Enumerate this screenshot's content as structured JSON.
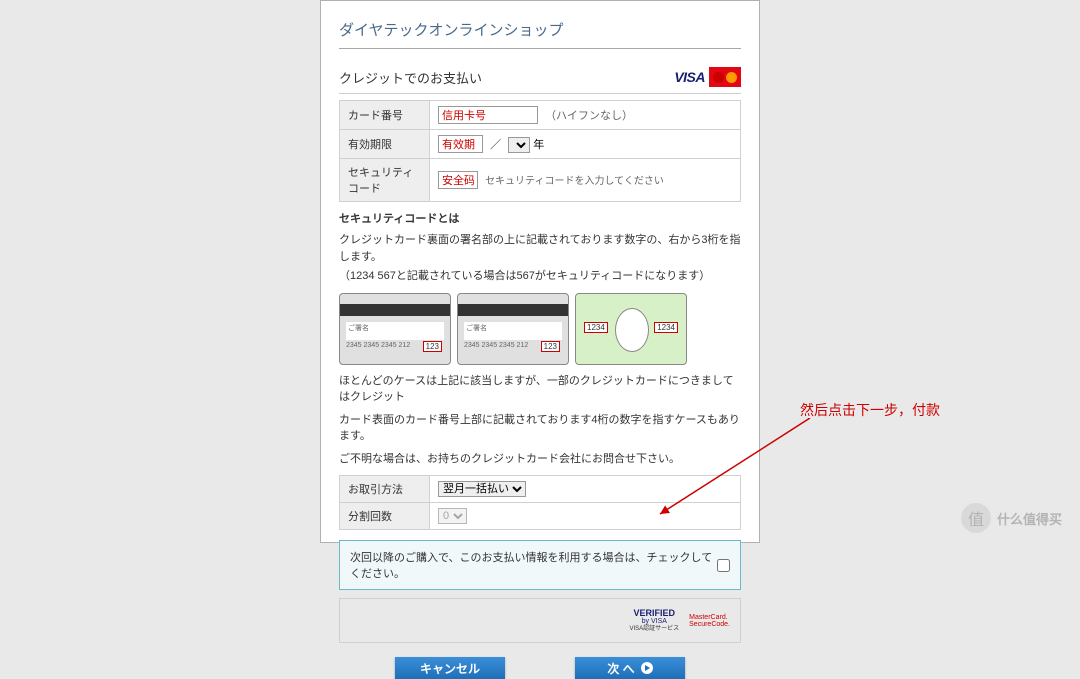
{
  "shop_title": "ダイヤテックオンラインショップ",
  "section_title": "クレジットでのお支払い",
  "logos": {
    "visa": "VISA",
    "mastercard": "MasterCard"
  },
  "form": {
    "card_number": {
      "label": "カード番号",
      "value": "信用卡号",
      "hint": "（ハイフンなし）"
    },
    "expiry": {
      "label": "有効期限",
      "month_value": "有效期",
      "slash": "／",
      "year_suffix": "年"
    },
    "security": {
      "label": "セキュリティコード",
      "value": "安全码",
      "placeholder": "セキュリティコードを入力してください"
    },
    "method": {
      "label": "お取引方法",
      "selected": "翌月一括払い"
    },
    "installments": {
      "label": "分割回数",
      "value": "0"
    }
  },
  "sec_info": {
    "title": "セキュリティコードとは",
    "desc1": "クレジットカード裏面の署名部の上に記載されております数字の、右から3桁を指します。",
    "desc2": "（1234 567と記載されている場合は567がセキュリティコードになります）",
    "sig_label": "ご署名",
    "card_nums": "2345 2345 2345 212",
    "code3": "123",
    "code4": "1234",
    "note1": "ほとんどのケースは上記に該当しますが、一部のクレジットカードにつきましてはクレジット",
    "note2": "カード表面のカード番号上部に記載されております4桁の数字を指すケースもあります。",
    "note3": "ご不明な場合は、お持ちのクレジットカード会社にお問合せ下さい。"
  },
  "save_text": "次回以降のご購入で、このお支払い情報を利用する場合は、チェックしてください。",
  "sec_logos": {
    "vbv_top": "VERIFIED",
    "vbv_by": "by VISA",
    "vbv_sub": "VISA認証サービス",
    "mcsc1": "MasterCard.",
    "mcsc2": "SecureCode."
  },
  "buttons": {
    "cancel": "キャンセル",
    "next": "次 へ"
  },
  "annotation": "然后点击下一步，付款",
  "watermark": {
    "icon": "值",
    "text": "什么值得买"
  }
}
